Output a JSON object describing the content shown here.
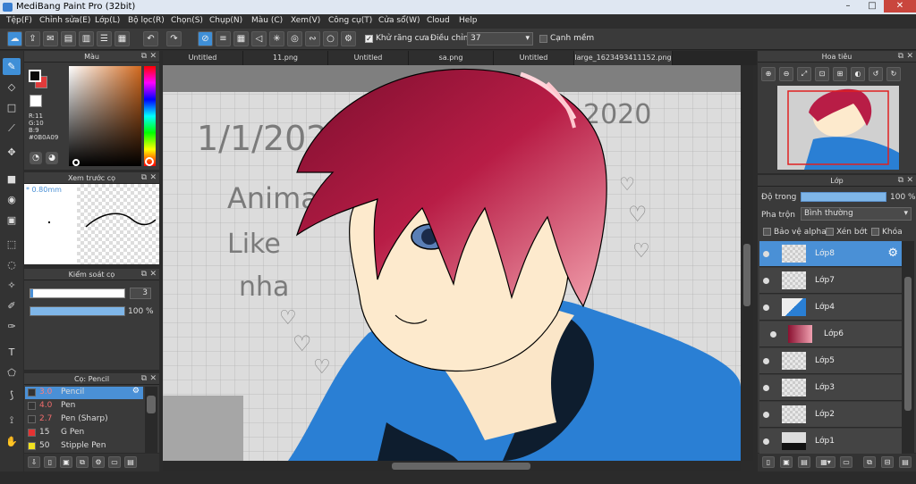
{
  "window": {
    "title": "MediBang Paint Pro (32bit)",
    "minimize": "–",
    "maximize": "□",
    "close": "✕"
  },
  "menu": [
    "Tệp(F)",
    "Chỉnh sửa(E)",
    "Lớp(L)",
    "Bộ lọc(R)",
    "Chọn(S)",
    "Chụp(N)",
    "Màu (C)",
    "Xem(V)",
    "Công cụ(T)",
    "Cửa sổ(W)",
    "Cloud",
    "Help"
  ],
  "toolbar": {
    "antialias_label": "Khử răng cưa",
    "adjust_label": "Điều chỉnh",
    "adjust_value": "37",
    "snap_label": "Cạnh mềm"
  },
  "color_panel": {
    "title": "Màu",
    "r": "R:11",
    "g": "G:10",
    "b": "B:9",
    "hex": "#0B0A09",
    "fg": "#0b0a09",
    "bg": "#e23b3b"
  },
  "brush_preview": {
    "title": "Xem trước cọ",
    "size": "0.80mm"
  },
  "brush_control": {
    "title": "Kiểm soát cọ",
    "size_value": "3",
    "opacity_value": "100 %",
    "opacity_fill": 1.0
  },
  "brush_list": {
    "title": "Cọ: Pencil",
    "items": [
      {
        "size": "3.0",
        "name": "Pencil",
        "color": "#333333",
        "selected": true
      },
      {
        "size": "4.0",
        "name": "Pen",
        "color": "#333333"
      },
      {
        "size": "2.7",
        "name": "Pen (Sharp)",
        "color": "#333333"
      },
      {
        "size": "15",
        "name": "G Pen",
        "color": "#e53232"
      },
      {
        "size": "50",
        "name": "Stipple Pen",
        "color": "#f0e020"
      }
    ]
  },
  "tabs": [
    "Untitled",
    "11.png",
    "Untitled",
    "sa.png",
    "Untitled",
    "large_1623493411152.png"
  ],
  "navigator": {
    "title": "Hoa tiêu"
  },
  "layers_panel": {
    "title": "Lớp",
    "opacity_label": "Độ trong",
    "opacity_value": "100 %",
    "blend_label": "Pha trộn",
    "blend_value": "Bình thường",
    "protect_alpha": "Bảo vệ alpha",
    "clipping": "Xén bớt",
    "lock": "Khóa",
    "layers": [
      "Lớp8",
      "Lớp7",
      "Lớp4",
      "Lớp6",
      "Lớp5",
      "Lớp3",
      "Lớp2",
      "Lớp1"
    ]
  },
  "paper_text": {
    "date_left": "1/1/2020",
    "date_right": "2020",
    "line1": "Anima",
    "line2": "Like",
    "line3": "nha"
  }
}
